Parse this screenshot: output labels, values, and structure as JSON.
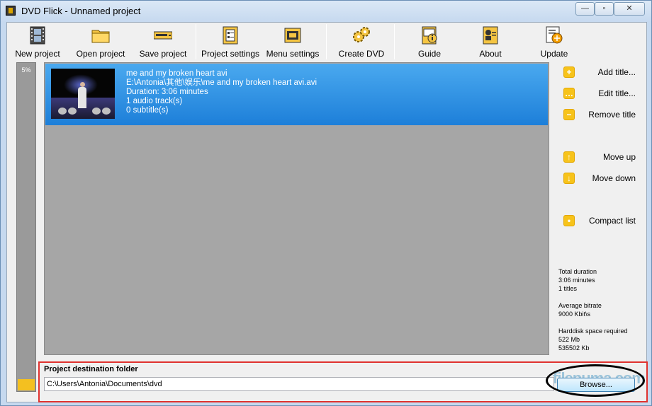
{
  "window": {
    "title": "DVD Flick - Unnamed project",
    "controls": {
      "minimize": "—",
      "maximize": "▫",
      "close": "✕"
    }
  },
  "toolbar": {
    "new_project": "New project",
    "open_project": "Open project",
    "save_project": "Save project",
    "project_settings": "Project settings",
    "menu_settings": "Menu settings",
    "create_dvd": "Create DVD",
    "guide": "Guide",
    "about": "About",
    "update": "Update"
  },
  "progress": {
    "label": "5%",
    "value": 0.05
  },
  "titles": [
    {
      "name": "me and my broken heart avi",
      "path": "E:\\Antonia\\其他\\娱乐\\me and my broken heart avi.avi",
      "duration": "Duration: 3:06 minutes",
      "audio": "1 audio track(s)",
      "subtitles": "0 subtitle(s)"
    }
  ],
  "sidebar": {
    "add_title": "Add title...",
    "edit_title": "Edit title...",
    "remove_title": "Remove title",
    "move_up": "Move up",
    "move_down": "Move down",
    "compact_list": "Compact list"
  },
  "stats": {
    "total_duration_label": "Total duration",
    "total_duration_value": "3:06 minutes",
    "titles_count": "1 titles",
    "bitrate_label": "Average bitrate",
    "bitrate_value": "9000 Kbit\\s",
    "space_label": "Harddisk space required",
    "space_mb": "522 Mb",
    "space_kb": "535502 Kb"
  },
  "destination": {
    "label": "Project destination folder",
    "path": "C:\\Users\\Antonia\\Documents\\dvd",
    "browse": "Browse..."
  },
  "watermark": "filepuma.com",
  "colors": {
    "selection": "#1d7fd9",
    "icon_yellow": "#f7c31a",
    "highlight_box": "#e0322f"
  }
}
